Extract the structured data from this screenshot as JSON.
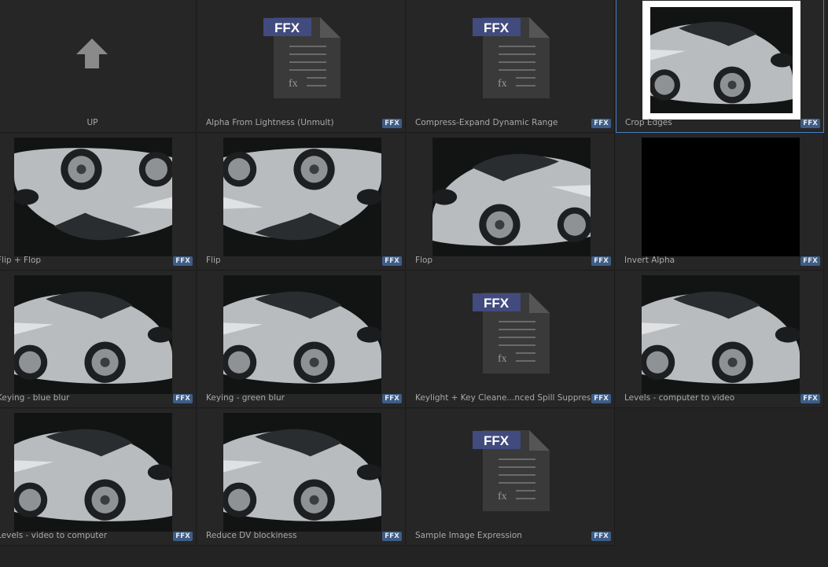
{
  "items": [
    {
      "label": "UP",
      "badge": ""
    },
    {
      "label": "Alpha From Lightness (Unmult)",
      "badge": "FFX"
    },
    {
      "label": "Compress-Expand Dynamic Range",
      "badge": "FFX"
    },
    {
      "label": "Crop Edges",
      "badge": "FFX"
    },
    {
      "label": "Flip + Flop",
      "badge": "FFX"
    },
    {
      "label": "Flip",
      "badge": "FFX"
    },
    {
      "label": "Flop",
      "badge": "FFX"
    },
    {
      "label": "Invert Alpha",
      "badge": "FFX"
    },
    {
      "label": "Keying - blue blur",
      "badge": "FFX"
    },
    {
      "label": "Keying - green blur",
      "badge": "FFX"
    },
    {
      "label": "Keylight + Key Cleane...nced Spill Suppressor",
      "badge": "FFX"
    },
    {
      "label": "Levels - computer to video",
      "badge": "FFX"
    },
    {
      "label": "Levels - video to computer",
      "badge": "FFX"
    },
    {
      "label": "Reduce DV blockiness",
      "badge": "FFX"
    },
    {
      "label": "Sample Image Expression",
      "badge": "FFX"
    }
  ],
  "doc_icon": {
    "header": "FFX",
    "glyph": "fx"
  },
  "colors": {
    "accent": "#4a7fc4",
    "badge_bg": "#3e5d86",
    "doc_header": "#3f4a7a"
  }
}
